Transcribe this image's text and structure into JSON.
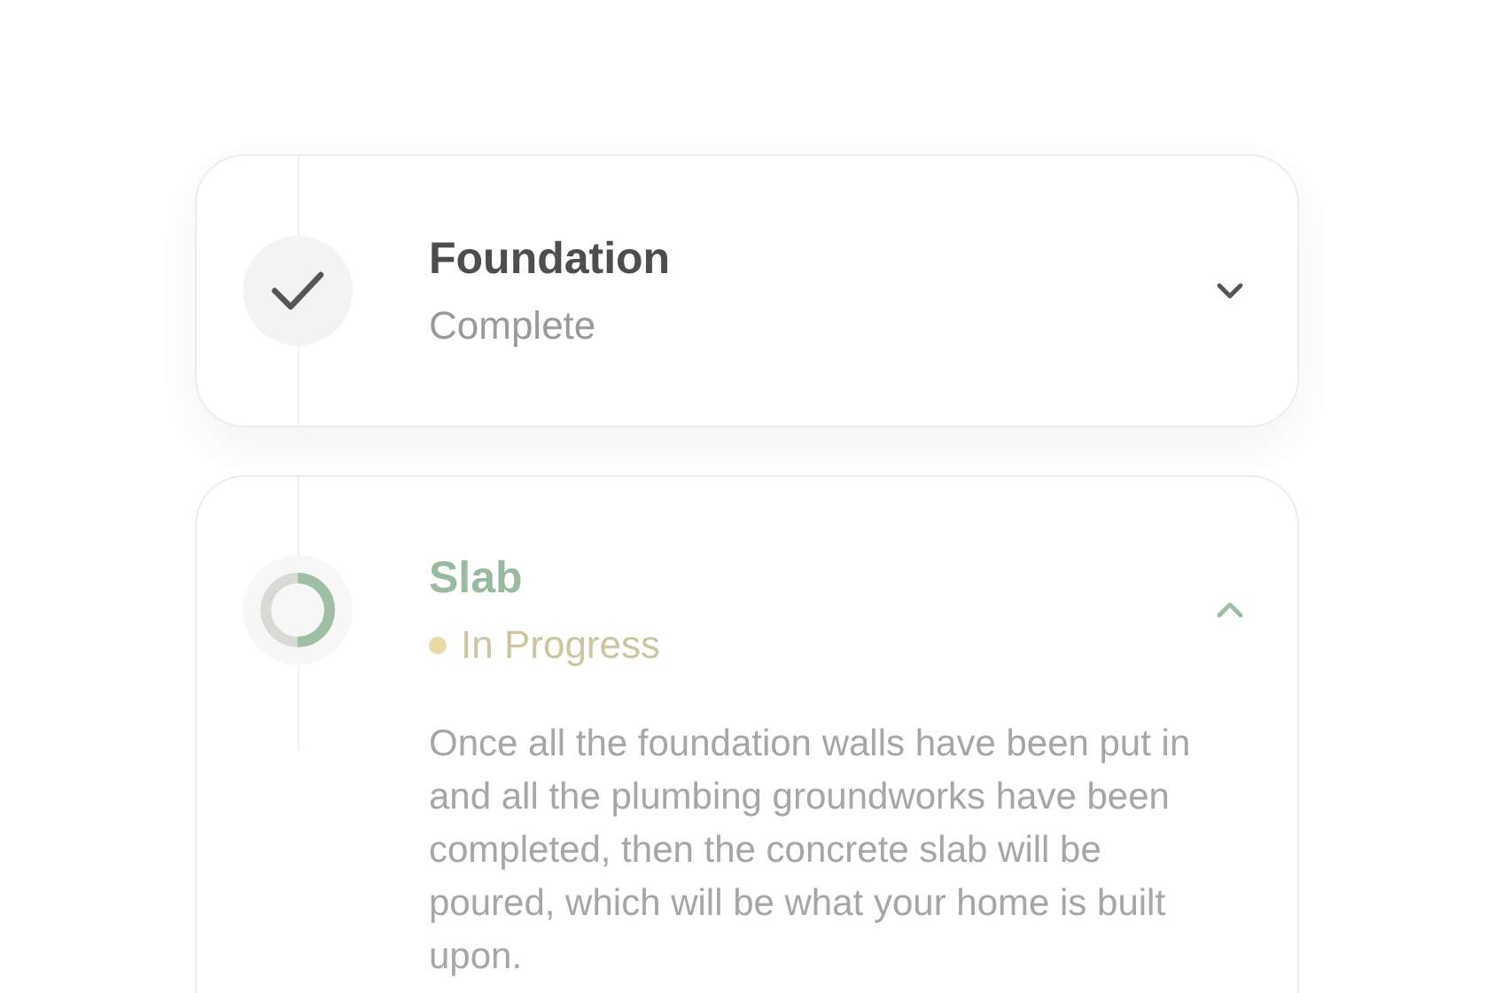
{
  "steps": [
    {
      "title": "Foundation",
      "status": "Complete",
      "kind": "complete",
      "expanded": false
    },
    {
      "title": "Slab",
      "status": "In Progress",
      "kind": "in_progress",
      "expanded": true,
      "level": 0.5,
      "color": "#ead9a6",
      "description": "Once all the foundation walls have been put in and all the plumbing groundworks have been completed, then the concrete slab will be poured, which will be what your home is built upon."
    }
  ]
}
